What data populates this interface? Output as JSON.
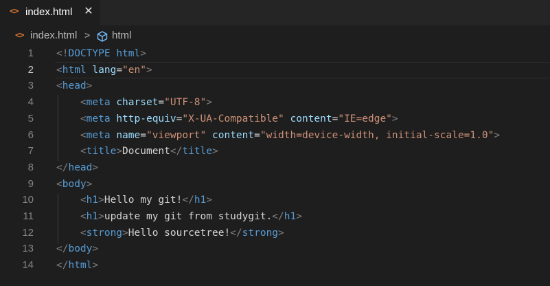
{
  "tab": {
    "label": "index.html",
    "icon": "html-file-icon",
    "close": "✕"
  },
  "breadcrumb": {
    "file_icon": "<>",
    "file": "index.html",
    "separator": ">",
    "symbol_icon": "cube-icon",
    "symbol": "html"
  },
  "editor": {
    "active_line": 2,
    "lines": [
      {
        "n": "1",
        "tokens": [
          [
            "br",
            "<!"
          ],
          [
            "doc",
            "DOCTYPE "
          ],
          [
            "tag",
            "html"
          ],
          [
            "br",
            ">"
          ]
        ]
      },
      {
        "n": "2",
        "tokens": [
          [
            "br",
            "<"
          ],
          [
            "tag",
            "html "
          ],
          [
            "attr",
            "lang"
          ],
          [
            "txt",
            "="
          ],
          [
            "str",
            "\"en\""
          ],
          [
            "br",
            ">"
          ]
        ]
      },
      {
        "n": "3",
        "tokens": [
          [
            "br",
            "<"
          ],
          [
            "tag",
            "head"
          ],
          [
            "br",
            ">"
          ]
        ]
      },
      {
        "n": "4",
        "tokens": [
          [
            "txt",
            "    "
          ],
          [
            "br",
            "<"
          ],
          [
            "tag",
            "meta "
          ],
          [
            "attr",
            "charset"
          ],
          [
            "txt",
            "="
          ],
          [
            "str",
            "\"UTF-8\""
          ],
          [
            "br",
            ">"
          ]
        ]
      },
      {
        "n": "5",
        "tokens": [
          [
            "txt",
            "    "
          ],
          [
            "br",
            "<"
          ],
          [
            "tag",
            "meta "
          ],
          [
            "attr",
            "http-equiv"
          ],
          [
            "txt",
            "="
          ],
          [
            "str",
            "\"X-UA-Compatible\""
          ],
          [
            "txt",
            " "
          ],
          [
            "attr",
            "content"
          ],
          [
            "txt",
            "="
          ],
          [
            "str",
            "\"IE=edge\""
          ],
          [
            "br",
            ">"
          ]
        ]
      },
      {
        "n": "6",
        "tokens": [
          [
            "txt",
            "    "
          ],
          [
            "br",
            "<"
          ],
          [
            "tag",
            "meta "
          ],
          [
            "attr",
            "name"
          ],
          [
            "txt",
            "="
          ],
          [
            "str",
            "\"viewport\""
          ],
          [
            "txt",
            " "
          ],
          [
            "attr",
            "content"
          ],
          [
            "txt",
            "="
          ],
          [
            "str",
            "\"width=device-width, initial-scale=1.0\""
          ],
          [
            "br",
            ">"
          ]
        ]
      },
      {
        "n": "7",
        "tokens": [
          [
            "txt",
            "    "
          ],
          [
            "br",
            "<"
          ],
          [
            "tag",
            "title"
          ],
          [
            "br",
            ">"
          ],
          [
            "txt",
            "Document"
          ],
          [
            "br",
            "</"
          ],
          [
            "tag",
            "title"
          ],
          [
            "br",
            ">"
          ]
        ]
      },
      {
        "n": "8",
        "tokens": [
          [
            "br",
            "</"
          ],
          [
            "tag",
            "head"
          ],
          [
            "br",
            ">"
          ]
        ]
      },
      {
        "n": "9",
        "tokens": [
          [
            "br",
            "<"
          ],
          [
            "tag",
            "body"
          ],
          [
            "br",
            ">"
          ]
        ]
      },
      {
        "n": "10",
        "tokens": [
          [
            "txt",
            "    "
          ],
          [
            "br",
            "<"
          ],
          [
            "tag",
            "h1"
          ],
          [
            "br",
            ">"
          ],
          [
            "txt",
            "Hello my git!"
          ],
          [
            "br",
            "</"
          ],
          [
            "tag",
            "h1"
          ],
          [
            "br",
            ">"
          ]
        ]
      },
      {
        "n": "11",
        "tokens": [
          [
            "txt",
            "    "
          ],
          [
            "br",
            "<"
          ],
          [
            "tag",
            "h1"
          ],
          [
            "br",
            ">"
          ],
          [
            "txt",
            "update my git from studygit."
          ],
          [
            "br",
            "</"
          ],
          [
            "tag",
            "h1"
          ],
          [
            "br",
            ">"
          ]
        ]
      },
      {
        "n": "12",
        "tokens": [
          [
            "txt",
            "    "
          ],
          [
            "br",
            "<"
          ],
          [
            "tag",
            "strong"
          ],
          [
            "br",
            ">"
          ],
          [
            "txt",
            "Hello sourcetree!"
          ],
          [
            "br",
            "</"
          ],
          [
            "tag",
            "strong"
          ],
          [
            "br",
            ">"
          ]
        ]
      },
      {
        "n": "13",
        "tokens": [
          [
            "br",
            "</"
          ],
          [
            "tag",
            "body"
          ],
          [
            "br",
            ">"
          ]
        ]
      },
      {
        "n": "14",
        "tokens": [
          [
            "br",
            "</"
          ],
          [
            "tag",
            "html"
          ],
          [
            "br",
            ">"
          ]
        ]
      }
    ]
  },
  "colors": {
    "background": "#1e1e1e",
    "tab_bar": "#252526",
    "tag": "#569cd6",
    "attribute": "#9cdcfe",
    "string": "#ce9178",
    "bracket": "#808080",
    "text": "#d4d4d4",
    "html_icon": "#e37933"
  }
}
